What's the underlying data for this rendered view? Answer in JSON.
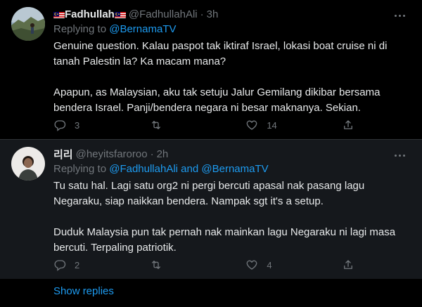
{
  "tweets": [
    {
      "display_name": "Fadhullah",
      "handle": "@FadhullahAli",
      "time": "3h",
      "replying_prefix": "Replying to ",
      "replying_to": [
        "@BernamaTV"
      ],
      "replying_join": "",
      "paragraphs": [
        "Genuine question. Kalau paspot tak iktiraf Israel, lokasi boat cruise ni di tanah Palestin la? Ka macam mana?",
        "Apapun, as Malaysian, aku tak setuju Jalur Gemilang dikibar bersama bendera Israel. Panji/bendera negara ni besar maknanya. Sekian."
      ],
      "reply_count": "3",
      "retweet_count": "",
      "like_count": "14"
    },
    {
      "display_name": "리리",
      "handle": "@heyitsfaroroo",
      "time": "2h",
      "replying_prefix": "Replying to ",
      "replying_to": [
        "@FadhullahAli",
        "@BernamaTV"
      ],
      "replying_join": " and ",
      "paragraphs": [
        "Tu satu hal. Lagi satu org2 ni pergi bercuti apasal nak pasang lagu Negaraku, siap naikkan bendera. Nampak sgt it's a setup.",
        "Duduk Malaysia pun tak pernah nak mainkan lagu Negaraku ni lagi masa bercuti. Terpaling patriotik."
      ],
      "reply_count": "2",
      "retweet_count": "",
      "like_count": "4"
    }
  ],
  "dot_separator": "·",
  "show_replies_label": "Show replies",
  "icons": {
    "reply": "reply-icon",
    "retweet": "retweet-icon",
    "like": "heart-icon",
    "share": "share-icon",
    "more": "more-icon",
    "flag": "malaysia-flag-icon"
  },
  "colors": {
    "background": "#000000",
    "highlight_background": "#15181c",
    "text": "#e7e9ea",
    "muted": "#71767b",
    "accent": "#1d9bf0",
    "divider": "#2f3336"
  }
}
